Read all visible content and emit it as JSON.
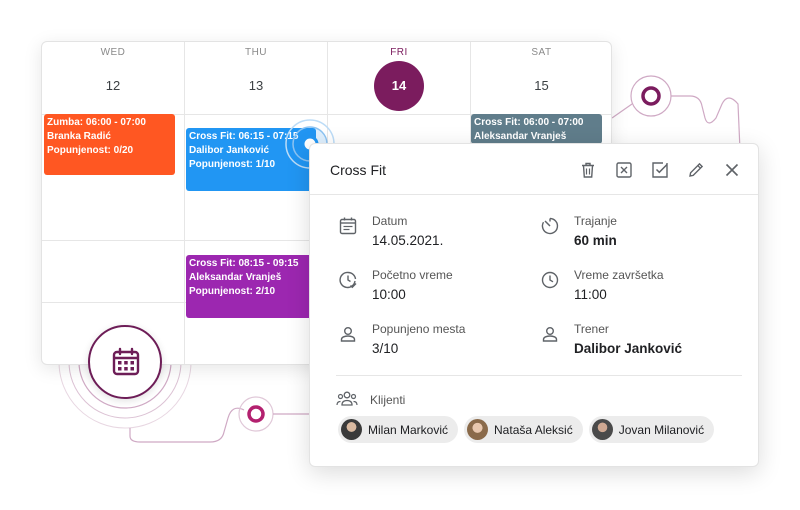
{
  "calendar": {
    "days": [
      {
        "name": "WED",
        "number": "12",
        "today": false
      },
      {
        "name": "THU",
        "number": "13",
        "today": false
      },
      {
        "name": "FRI",
        "number": "14",
        "today": true
      },
      {
        "name": "SAT",
        "number": "15",
        "today": false
      }
    ],
    "events": [
      {
        "title": "Zumba: 06:00 - 07:00",
        "trainer": "Branka Radić",
        "occupancy": "Popunjenost: 0/20",
        "color": "#ff5722"
      },
      {
        "title": "Cross Fit: 06:15 - 07:15",
        "trainer": "Dalibor Janković",
        "occupancy": "Popunjenost: 1/10",
        "color": "#2196f3"
      },
      {
        "title": "Cross Fit: 08:15 - 09:15",
        "trainer": "Aleksandar Vranješ",
        "occupancy": "Popunjenost: 2/10",
        "color": "#9c27b0"
      },
      {
        "title": "Cross Fit: 06:00 - 07:00",
        "trainer": "Aleksandar Vranješ",
        "occupancy": "",
        "color": "#607d8b"
      }
    ],
    "today_color": "#7b1c5e"
  },
  "panel": {
    "title": "Cross Fit",
    "toolbar": [
      {
        "icon": "trash-icon"
      },
      {
        "icon": "close-box-icon"
      },
      {
        "icon": "check-box-icon"
      },
      {
        "icon": "pencil-icon"
      },
      {
        "icon": "close-icon"
      }
    ],
    "fields": {
      "date": {
        "label": "Datum",
        "value": "14.05.2021.",
        "icon": "calendar-note-icon"
      },
      "duration": {
        "label": "Trajanje",
        "value": "60 min",
        "icon": "timer-icon"
      },
      "start": {
        "label": "Početno vreme",
        "value": "10:00",
        "icon": "clock-check-icon"
      },
      "end": {
        "label": "Vreme završetka",
        "value": "11:00",
        "icon": "clock-icon"
      },
      "occupied": {
        "label": "Popunjeno mesta",
        "value": "3/10",
        "icon": "person-icon"
      },
      "trainer": {
        "label": "Trener",
        "value": "Dalibor Janković",
        "icon": "person-icon"
      }
    },
    "clients_label": "Klijenti",
    "clients": [
      {
        "name": "Milan Marković"
      },
      {
        "name": "Nataša Aleksić"
      },
      {
        "name": "Jovan Milanović"
      }
    ]
  },
  "accent_color": "#7b1c5e"
}
